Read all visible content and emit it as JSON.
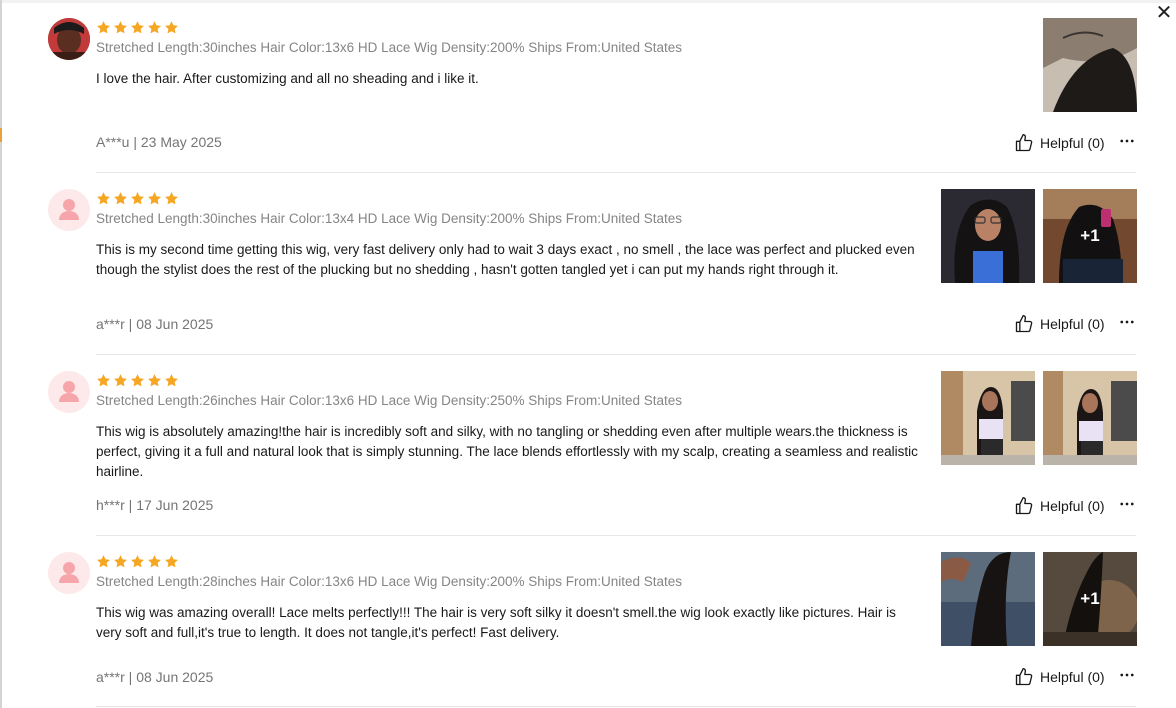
{
  "dialog": {
    "close_icon": "close-icon",
    "close_glyph": "✕"
  },
  "colors": {
    "star": "#f5a623",
    "specs": "#858585",
    "meta": "#757575",
    "divider": "#e6e6e6",
    "avatar_bg": "#fde9ea",
    "avatar_fg": "#f6a6aa"
  },
  "reviews": [
    {
      "rating": 5,
      "specs": "Stretched Length:30inches Hair Color:13x6 HD Lace Wig Density:200% Ships From:United States",
      "text": "I love the hair. After customizing and all no sheading and i like it.",
      "author_date": "A***u | 23 May 2025",
      "helpful": "Helpful (0)",
      "avatar": "photo",
      "extra_photos": ""
    },
    {
      "rating": 5,
      "specs": "Stretched Length:30inches Hair Color:13x4 HD Lace Wig Density:200% Ships From:United States",
      "text": "This is my second time getting this wig, very fast delivery only had to wait 3 days exact , no smell , the lace was perfect and plucked even though the stylist does the rest of the plucking but no shedding , hasn't gotten tangled yet i can put my hands right through it.",
      "author_date": "a***r | 08 Jun 2025",
      "helpful": "Helpful (0)",
      "avatar": "default",
      "extra_photos": "+1"
    },
    {
      "rating": 5,
      "specs": "Stretched Length:26inches Hair Color:13x6 HD Lace Wig Density:250% Ships From:United States",
      "text": "This wig is absolutely amazing!the hair is incredibly soft and silky, with no tangling or shedding even after multiple wears.the thickness is perfect, giving it a full and natural look that is simply stunning. The lace blends effortlessly with my scalp, creating a seamless and realistic hairline.",
      "author_date": "h***r | 17 Jun 2025",
      "helpful": "Helpful (0)",
      "avatar": "default",
      "extra_photos": ""
    },
    {
      "rating": 5,
      "specs": "Stretched Length:28inches Hair Color:13x6 HD Lace Wig Density:200% Ships From:United States",
      "text": "This wig was amazing overall! Lace melts perfectly!!! The hair is very soft silky it doesn't smell.the wig look exactly like pictures. Hair is very soft and full,it's true to length. It does not tangle,it's perfect! Fast delivery.",
      "author_date": "a***r | 08 Jun 2025",
      "helpful": "Helpful (0)",
      "avatar": "default",
      "extra_photos": "+1"
    }
  ]
}
